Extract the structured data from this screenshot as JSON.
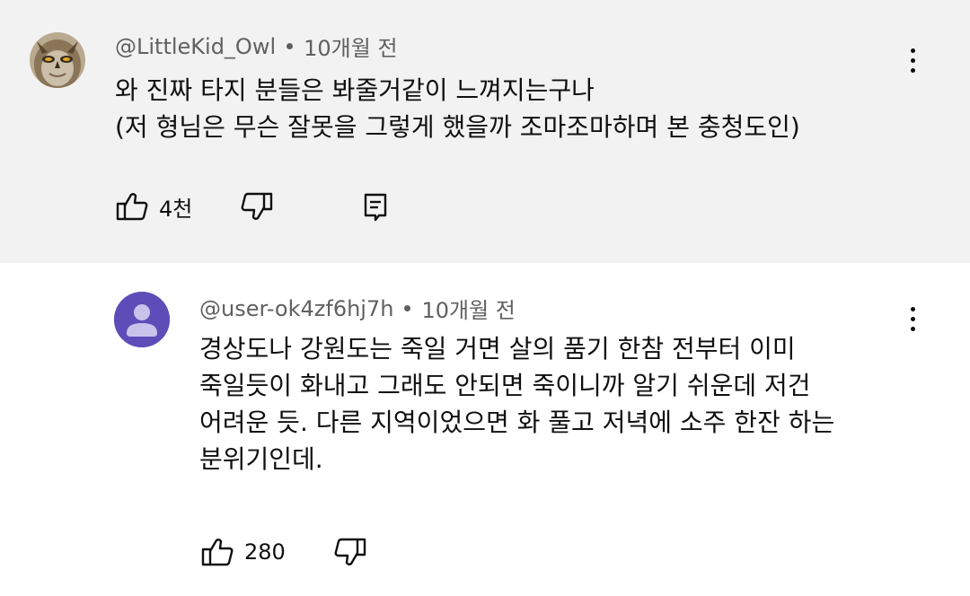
{
  "comments": [
    {
      "author": "@LittleKid_Owl",
      "time": "10개월 전",
      "avatar": "owl-photo-avatar",
      "lines": [
        "와 진짜 타지 분들은 봐줄거같이 느껴지는구나",
        "(저 형님은 무슨 잘못을 그렇게 했을까 조마조마하며 본 충청도인)"
      ],
      "like_count": "4천",
      "has_reply_button": true
    },
    {
      "author": "@user-ok4zf6hj7h",
      "time": "10개월 전",
      "avatar": "default-user-avatar",
      "lines": [
        "경상도나 강원도는 죽일 거면 살의 품기 한참 전부터 이미",
        "죽일듯이 화내고 그래도 안되면 죽이니까 알기 쉬운데 저건",
        "어려운 듯. 다른 지역이었으면 화 풀고 저녁에 소주 한잔 하는",
        "분위기인데."
      ],
      "like_count": "280",
      "has_reply_button": false
    }
  ],
  "colors": {
    "highlight_bg": "#f2f2f2",
    "text": "#0f0f0f",
    "meta_text": "#606060",
    "default_avatar": "#5e4db8"
  },
  "icons": {
    "like": "thumbs-up-icon",
    "dislike": "thumbs-down-icon",
    "reply": "comment-reply-icon",
    "menu": "more-vertical-icon"
  }
}
